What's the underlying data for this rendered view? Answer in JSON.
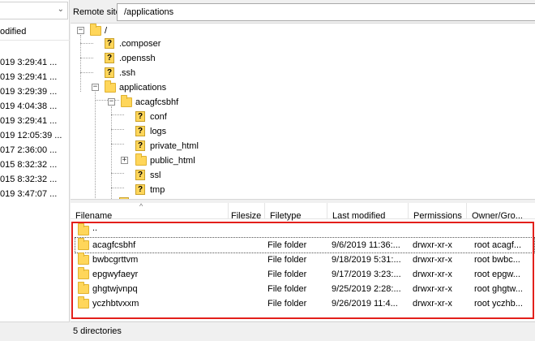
{
  "local": {
    "header_fragment": "odified",
    "dates": [
      "019 3:29:41 ...",
      "019 3:29:41 ...",
      "019 3:29:39 ...",
      "019 4:04:38 ...",
      "019 3:29:41 ...",
      "019 12:05:39 ...",
      "017 2:36:00 ...",
      "015 8:32:32 ...",
      "015 8:32:32 ...",
      "019 3:47:07 ..."
    ]
  },
  "remote": {
    "label": "Remote site:",
    "path": "/applications"
  },
  "tree": {
    "root": "/",
    "items": [
      ".composer",
      ".openssh",
      ".ssh",
      "applications",
      "acagfcsbhf",
      "conf",
      "logs",
      "private_html",
      "public_html",
      "ssl",
      "tmp"
    ]
  },
  "listing": {
    "columns": [
      "Filename",
      "Filesize",
      "Filetype",
      "Last modified",
      "Permissions",
      "Owner/Gro..."
    ],
    "parent": "..",
    "rows": [
      {
        "name": "acagfcsbhf",
        "size": "",
        "type": "File folder",
        "modified": "9/6/2019 11:36:...",
        "perms": "drwxr-xr-x",
        "owner": "root acagf..."
      },
      {
        "name": "bwbcgrttvm",
        "size": "",
        "type": "File folder",
        "modified": "9/18/2019 5:31:...",
        "perms": "drwxr-xr-x",
        "owner": "root bwbc..."
      },
      {
        "name": "epgwyfaeyr",
        "size": "",
        "type": "File folder",
        "modified": "9/17/2019 3:23:...",
        "perms": "drwxr-xr-x",
        "owner": "root epgw..."
      },
      {
        "name": "ghgtwjvnpq",
        "size": "",
        "type": "File folder",
        "modified": "9/25/2019 2:28:...",
        "perms": "drwxr-xr-x",
        "owner": "root ghgtw..."
      },
      {
        "name": "yczhbtvxxm",
        "size": "",
        "type": "File folder",
        "modified": "9/26/2019 11:4...",
        "perms": "drwxr-xr-x",
        "owner": "root yczhb..."
      }
    ]
  },
  "status": {
    "text": "5 directories"
  },
  "colors": {
    "highlight": "#e3201b",
    "folder": "#ffd65a"
  }
}
